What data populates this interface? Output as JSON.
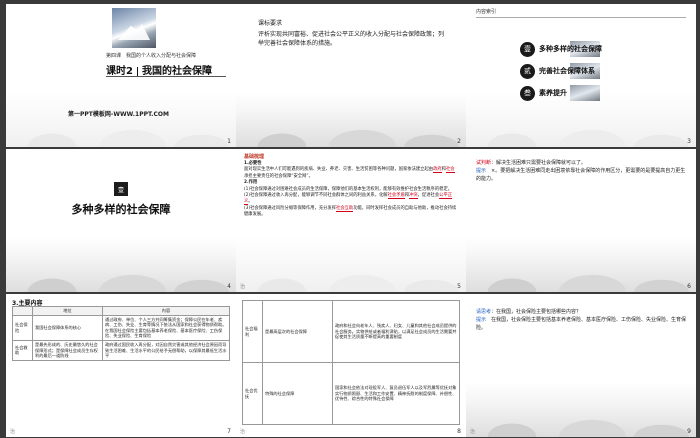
{
  "slides": [
    {
      "number": "1",
      "unit": "第四课　我国的个人收入分配与社会保障",
      "lesson": "课时2",
      "title": "我国的社会保障",
      "site": "第一PPT模板网-WWW.1PPT.COM"
    },
    {
      "number": "2",
      "heading": "课标要求",
      "body": "评析实现共同富裕、促进社会公平正义的收入分配与社会保障政策；列举完善社会保障体系的措施。"
    },
    {
      "number": "3",
      "heading": "内容索引",
      "items": [
        {
          "badge": "壹",
          "text": "多种多样的社会保障"
        },
        {
          "badge": "贰",
          "text": "完善社会保障体系"
        },
        {
          "badge": "叁",
          "text": "素养提升"
        }
      ]
    },
    {
      "number": "4",
      "badge": "壹",
      "title": "多种多样的社会保障"
    },
    {
      "number": "5",
      "heading": "基础梳理",
      "s1": "1.必要性",
      "p1": "面对现实生活中人们可能遇到的疾病、失业、养老、灾害、生活贫困等各种问题，国家依法建立起由",
      "p1r1": "政府",
      "p1m": "和",
      "p1r2": "社会",
      "p1e": "承担主要责任的社会保障“安全网”。",
      "s2": "2.作用",
      "w1": "(1)社会保障通过对困难社会成员的生活保障，保障他们的基本生活权利，能够有效维护社会生活秩序的稳定。",
      "w2a": "(2)社会保障通过收入再分配，能够调节不同社会群体之间的利益关系，化解",
      "w2r1": "社会矛盾",
      "w2b": "和",
      "w2r2": "冲突",
      "w2c": "，促进社会",
      "w2r3": "公平正义",
      "w2d": "。",
      "w3a": "(3)社会保障通过风险分摊等保障作用，充分发挥",
      "w3r": "社会互助",
      "w3b": "功能，同时发挥社会成员的自助与他助，推动社会持续健康发展。",
      "lbl": "治"
    },
    {
      "number": "6",
      "q_label": "试判断",
      "q_text": "：解决生活困难只需要社会保障就可以了。",
      "tip_label": "提示",
      "tip_text": "×。要把解决生活困难同走出困境依靠社会保障的作用区分，更需要的是要提高自力更生的能力。"
    },
    {
      "number": "7",
      "section": "3.主要内容",
      "headers": [
        "",
        "地位",
        "内容"
      ],
      "rows": [
        {
          "name": "社会保险",
          "status": "我国社会保障体系的核心",
          "content": "通过政府、单位、个人三方共同筹集资金；保障公民在年老、疾病、工伤、失业、生育等情况下依法从国家和社会获得物质帮助。在我国社会保险主要包括基本养老保险、基本医疗保险、工伤保险、失业保险、生育保险"
        },
        {
          "name": "社会救助",
          "status": "是最先形成的、历史最悠久的社会保障形式；是保障社会成员生存权利的最后一道防线",
          "content": "政府通过国民收入再分配，对因自然灾害或其他经济社会原因而导致生活困难、生活水平的公民给予无偿帮助，以保障其最低生活水平"
        }
      ],
      "lbl": "治"
    },
    {
      "number": "8",
      "rows": [
        {
          "name": "社会福利",
          "status": "是最高层次的社会保障",
          "content": "政府和社会向老年人、残疾人、妇女、儿童和其他社会成员提供的社会服务。实物供给或者福利津贴，以满足社会成员的生活需要并促使其生活质量不断提高的重要制度"
        },
        {
          "name": "社会优抚",
          "status": "特殊的社会保障",
          "content": "国家和社会依法对现役军人、复员退伍军人以及军烈属等优抚对象实行物质照顾、生活和工作安置、精神抚慰的制度保障、补偿性、优待性、综合性的特殊社会保障"
        }
      ],
      "lbl": "治"
    },
    {
      "number": "9",
      "q_label": "请思考",
      "q_text": "：在我国，社会保险主要包括哪些内容？",
      "tip_label": "提示",
      "tip_text": "在我国，社会保险主要包括基本养老保险、基本医疗保险、工伤保险、失业保险、生育保险。",
      "lbl": "治"
    }
  ]
}
